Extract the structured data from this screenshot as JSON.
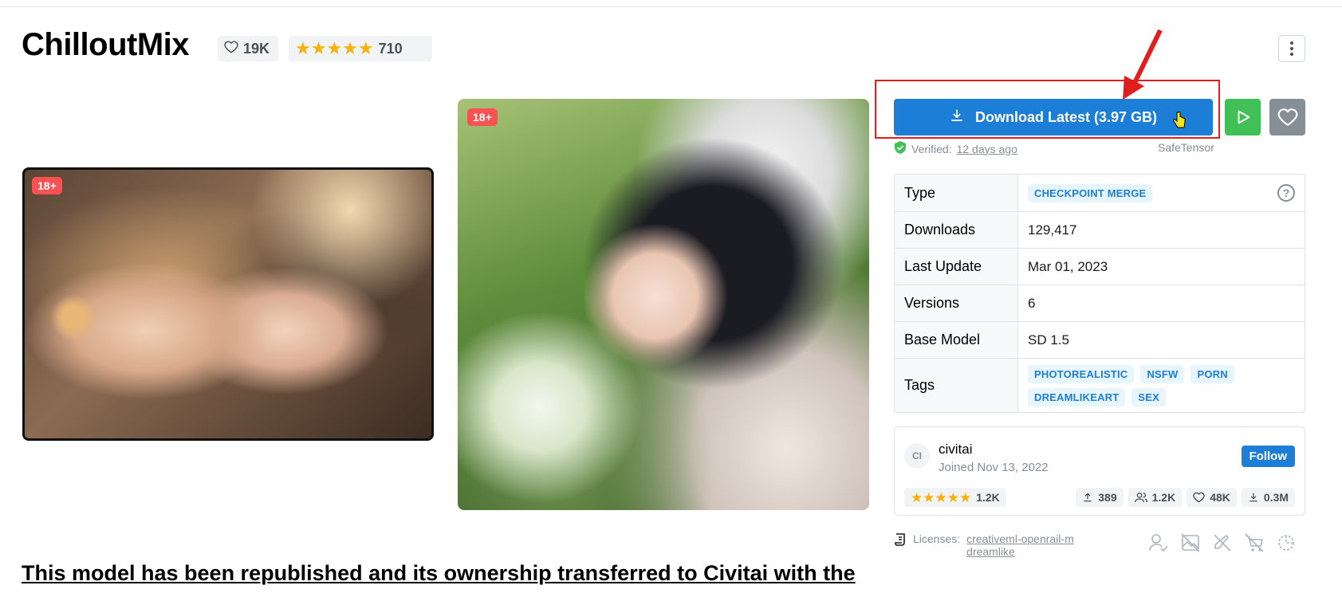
{
  "model": {
    "title": "ChilloutMix",
    "likes": "19K",
    "rating_count": "710",
    "rating_stars": 5
  },
  "images": [
    {
      "badge": "18+"
    },
    {
      "badge": "18+"
    }
  ],
  "download": {
    "label": "Download Latest (3.97 GB)",
    "verified_label": "Verified:",
    "verified_time": "12 days ago",
    "format": "SafeTensor"
  },
  "details": {
    "type_label": "Type",
    "type_value": "CHECKPOINT MERGE",
    "downloads_label": "Downloads",
    "downloads_value": "129,417",
    "last_update_label": "Last Update",
    "last_update_value": "Mar 01, 2023",
    "versions_label": "Versions",
    "versions_value": "6",
    "base_model_label": "Base Model",
    "base_model_value": "SD 1.5",
    "tags_label": "Tags",
    "tags": [
      "PHOTOREALISTIC",
      "NSFW",
      "PORN",
      "DREAMLIKEART",
      "SEX"
    ]
  },
  "creator": {
    "initials": "CI",
    "name": "civitai",
    "joined": "Joined Nov 13, 2022",
    "follow_label": "Follow",
    "rating_count": "1.2K",
    "uploads": "389",
    "followers": "1.2K",
    "favorites": "48K",
    "downloads": "0.3M"
  },
  "license": {
    "label": "Licenses:",
    "links": [
      "creativeml-openrail-m",
      "dreamlike"
    ]
  },
  "body": {
    "headline": "This model has been republished and its ownership transferred to Civitai with the"
  },
  "colors": {
    "primary": "#1c7ed6",
    "play": "#40c057",
    "heart_btn": "#868e96",
    "star": "#fab005",
    "badge": "#fa5252",
    "annotation": "#e01e1e"
  }
}
